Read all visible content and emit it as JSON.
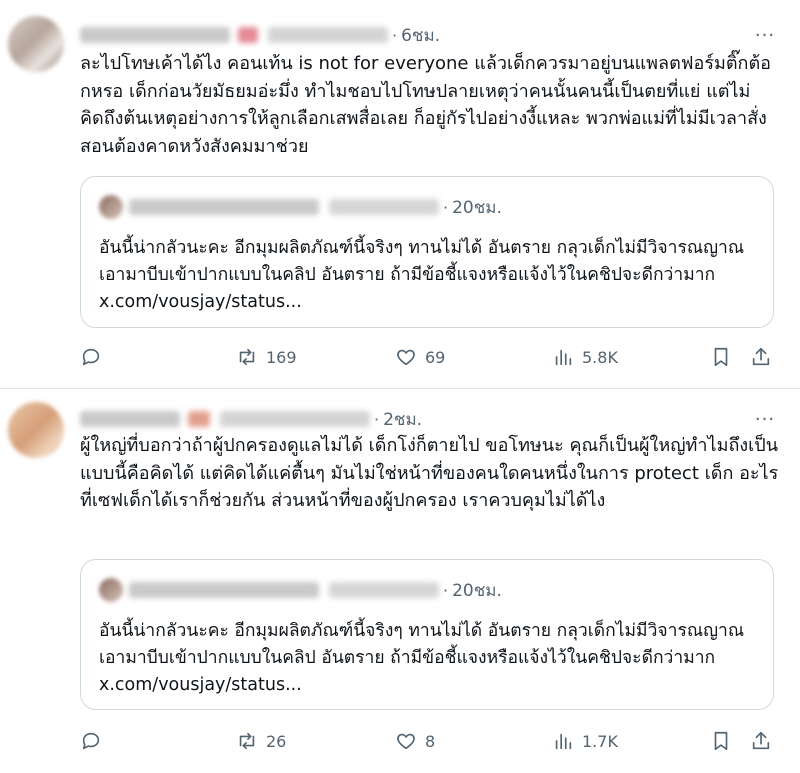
{
  "tweets": [
    {
      "time": "6ชม.",
      "more": "···",
      "text": "ละไปโทษเค้าได้ไง คอนเท้น is not for everyone แล้วเด็กควรมาอยู่บนแพลตฟอร์มติ๊กต้อกหรอ เด็กก่อนวัยมัธยมอ่ะมึ่ง ทำไมชอบไปโทษปลายเหตุว่าคนนั้นคนนี้เป็นตยที่แย่ แต่ไม่คิดถึงต้นเหตุอย่างการให้ลูกเลือกเสพสื่อเลย ก็อยู่กัรไปอย่างงี้แหละ พวกพ่อแม่ที่ไม่มีเวลาสั่งสอนต้องคาดหวังสังคมมาช่วย",
      "quote": {
        "time": "20ชม.",
        "text": "อันนี้น่ากลัวนะคะ อีกมุมผลิตภัณฑ์นี้จริงๆ ทานไม่ได้ อันตราย กลุวเด็กไม่มีวิจารณญาณเอามาบีบเข้าปากแบบในคลิป อันตราย ถ้ามีข้อชี้แจงหรือแจ้งไว้ในคชิปจะดีกว่ามาก x.com/vousjay/status..."
      },
      "stats": {
        "reposts": "169",
        "likes": "69",
        "views": "5.8K"
      }
    },
    {
      "time": "2ชม.",
      "more": "···",
      "text": "ผู้ใหญ่ที่บอกว่าถ้าผู้ปกครองดูแลไม่ได้ เด็กโง่ก็ตายไป ขอโทษนะ คุณก็เป็นผู้ใหญ่ทำไมถึงเป็นแบบนี้คือคิดได้ แต่คิดได้แค่ตื้นๆ มันไม่ใช่หน้าที่ของคนใดคนหนึ่งในการ protect เด็ก อะไรที่เซฟเด็กได้เราก็ช่วยกัน ส่วนหน้าที่ของผู้ปกครอง เราควบคุมไม่ได้ไง",
      "quote": {
        "time": "20ชม.",
        "text": "อันนี้น่ากลัวนะคะ อีกมุมผลิตภัณฑ์นี้จริงๆ ทานไม่ได้ อันตราย กลุวเด็กไม่มีวิจารณญาณเอามาบีบเข้าปากแบบในคลิป อันตราย ถ้ามีข้อชี้แจงหรือแจ้งไว้ในคชิปจะดีกว่ามาก x.com/vousjay/status..."
      },
      "stats": {
        "reposts": "26",
        "likes": "8",
        "views": "1.7K"
      }
    }
  ],
  "icons": {
    "reply": "reply-icon",
    "repost": "repost-icon",
    "like": "heart-icon",
    "views": "views-icon",
    "bookmark": "bookmark-icon",
    "share": "share-icon"
  },
  "colors": {
    "text": "#0f1419",
    "secondary": "#536471",
    "border": "#cfd9de",
    "divider": "#e1e6ea"
  }
}
